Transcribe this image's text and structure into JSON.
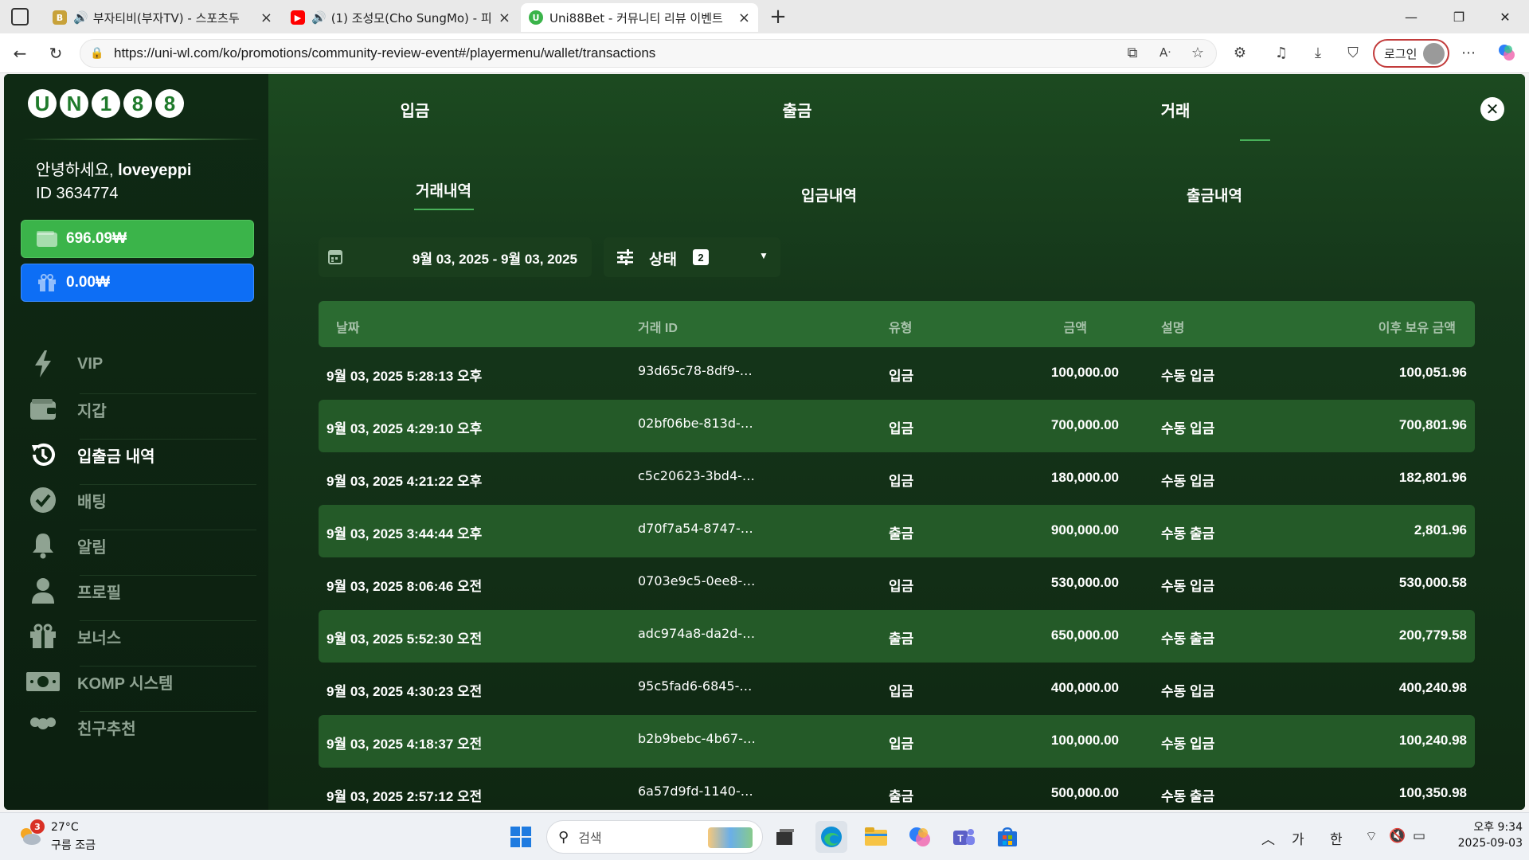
{
  "browser": {
    "tabs": [
      {
        "title": "부자티비(부자TV) - 스포츠두",
        "audio": true,
        "active": false
      },
      {
        "title": "(1) 조성모(Cho SungMo) - 피",
        "audio": true,
        "active": false
      },
      {
        "title": "Uni88Bet - 커뮤니티 리뷰 이벤트",
        "audio": false,
        "active": true
      }
    ],
    "url": "https://uni-wl.com/ko/promotions/community-review-event#/playermenu/wallet/transactions",
    "login_label": "로그인"
  },
  "sidebar": {
    "logo_letters": [
      "U",
      "N",
      "1",
      "8",
      "8"
    ],
    "greeting_prefix": "안녕하세요, ",
    "username": "loveyeppi",
    "user_id": "ID 3634774",
    "main_balance": "696.09₩",
    "bonus_balance": "0.00₩",
    "items": [
      {
        "label": "VIP",
        "icon": "lightning-icon",
        "active": false
      },
      {
        "label": "지갑",
        "icon": "wallet-icon",
        "active": false
      },
      {
        "label": "입출금 내역",
        "icon": "history-icon",
        "active": true
      },
      {
        "label": "배팅",
        "icon": "check-circle-icon",
        "active": false
      },
      {
        "label": "알림",
        "icon": "bell-icon",
        "active": false
      },
      {
        "label": "프로필",
        "icon": "user-icon",
        "active": false
      },
      {
        "label": "보너스",
        "icon": "gift-icon",
        "active": false
      },
      {
        "label": "KOMP 시스템",
        "icon": "cash-icon",
        "active": false
      },
      {
        "label": "친구추천",
        "icon": "users-icon",
        "active": false
      }
    ]
  },
  "main": {
    "top_tabs": [
      "입금",
      "출금",
      "거래"
    ],
    "active_top_tab": "거래",
    "sub_tabs": [
      "거래내역",
      "입금내역",
      "출금내역"
    ],
    "active_sub_tab": "거래내역",
    "date_range": "9월 03, 2025 - 9월 03, 2025",
    "status_label": "상태",
    "status_count": "2",
    "table": {
      "headers": [
        "날짜",
        "거래 ID",
        "유형",
        "금액",
        "설명",
        "이후 보유 금액"
      ],
      "rows": [
        {
          "date": "9월 03, 2025 5:28:13 오후",
          "id": "93d65c78-8df9-…",
          "type": "입금",
          "amount": "100,000.00",
          "desc": "수동 입금",
          "after": "100,051.96"
        },
        {
          "date": "9월 03, 2025 4:29:10 오후",
          "id": "02bf06be-813d-…",
          "type": "입금",
          "amount": "700,000.00",
          "desc": "수동 입금",
          "after": "700,801.96"
        },
        {
          "date": "9월 03, 2025 4:21:22 오후",
          "id": "c5c20623-3bd4-…",
          "type": "입금",
          "amount": "180,000.00",
          "desc": "수동 입금",
          "after": "182,801.96"
        },
        {
          "date": "9월 03, 2025 3:44:44 오후",
          "id": "d70f7a54-8747-…",
          "type": "출금",
          "amount": "900,000.00",
          "desc": "수동 출금",
          "after": "2,801.96"
        },
        {
          "date": "9월 03, 2025 8:06:46 오전",
          "id": "0703e9c5-0ee8-…",
          "type": "입금",
          "amount": "530,000.00",
          "desc": "수동 입금",
          "after": "530,000.58"
        },
        {
          "date": "9월 03, 2025 5:52:30 오전",
          "id": "adc974a8-da2d-…",
          "type": "출금",
          "amount": "650,000.00",
          "desc": "수동 출금",
          "after": "200,779.58"
        },
        {
          "date": "9월 03, 2025 4:30:23 오전",
          "id": "95c5fad6-6845-…",
          "type": "입금",
          "amount": "400,000.00",
          "desc": "수동 입금",
          "after": "400,240.98"
        },
        {
          "date": "9월 03, 2025 4:18:37 오전",
          "id": "b2b9bebc-4b67-…",
          "type": "입금",
          "amount": "100,000.00",
          "desc": "수동 입금",
          "after": "100,240.98"
        },
        {
          "date": "9월 03, 2025 2:57:12 오전",
          "id": "6a57d9fd-1140-…",
          "type": "출금",
          "amount": "500,000.00",
          "desc": "수동 출금",
          "after": "100,350.98"
        }
      ]
    }
  },
  "taskbar": {
    "weather_badge": "3",
    "temperature": "27°C",
    "condition": "구름 조금",
    "search_placeholder": "검색",
    "ime_1": "가",
    "ime_2": "한",
    "time": "오후 9:34",
    "date": "2025-09-03"
  },
  "colors": {
    "brand_green": "#3bb44a",
    "bonus_blue": "#0d6ef5",
    "row_alt": "#245a28",
    "header_bg": "#2b6b31"
  }
}
